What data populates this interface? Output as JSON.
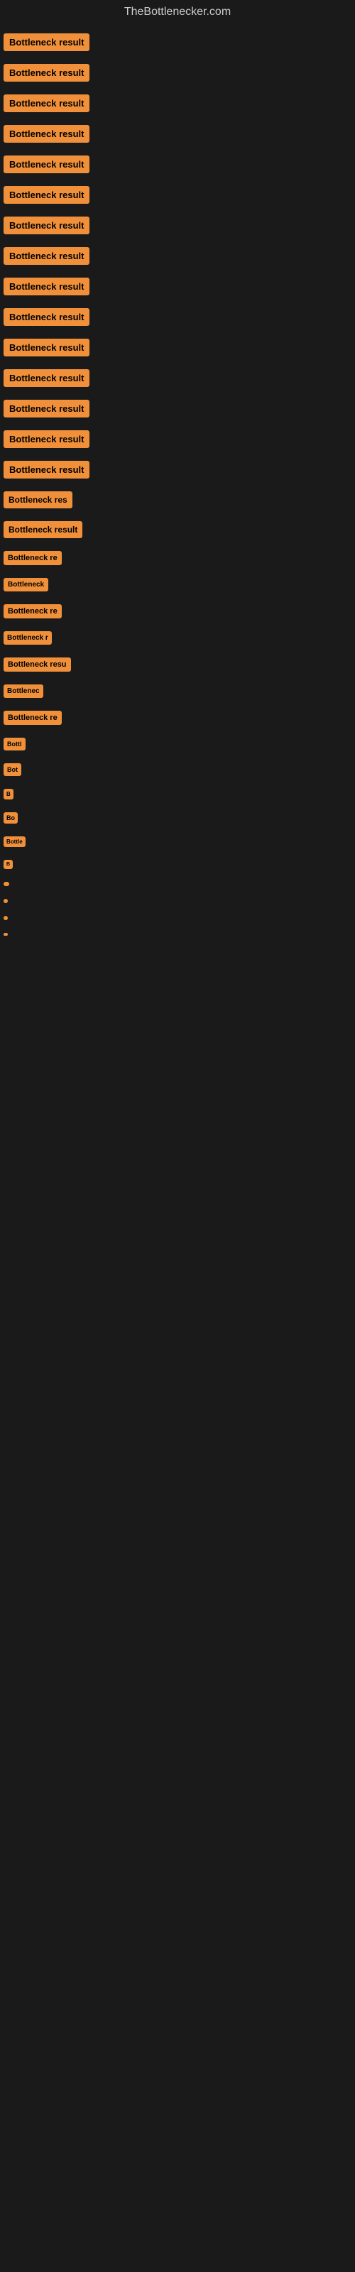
{
  "site": {
    "title": "TheBottlenecker.com"
  },
  "badges": [
    {
      "id": 1,
      "label": "Bottleneck result",
      "overflow": false
    },
    {
      "id": 2,
      "label": "Bottleneck result",
      "overflow": false
    },
    {
      "id": 3,
      "label": "Bottleneck result",
      "overflow": false
    },
    {
      "id": 4,
      "label": "Bottleneck result",
      "overflow": false
    },
    {
      "id": 5,
      "label": "Bottleneck result",
      "overflow": false
    },
    {
      "id": 6,
      "label": "Bottleneck result",
      "overflow": false
    },
    {
      "id": 7,
      "label": "Bottleneck result",
      "overflow": false
    },
    {
      "id": 8,
      "label": "Bottleneck result",
      "overflow": false
    },
    {
      "id": 9,
      "label": "Bottleneck result",
      "overflow": false
    },
    {
      "id": 10,
      "label": "Bottleneck result",
      "overflow": false
    },
    {
      "id": 11,
      "label": "Bottleneck result",
      "overflow": false
    },
    {
      "id": 12,
      "label": "Bottleneck result",
      "overflow": false
    },
    {
      "id": 13,
      "label": "Bottleneck result",
      "overflow": false
    },
    {
      "id": 14,
      "label": "Bottleneck result",
      "overflow": false
    },
    {
      "id": 15,
      "label": "Bottleneck result",
      "overflow": false
    },
    {
      "id": 16,
      "label": "Bottleneck res",
      "overflow": true
    },
    {
      "id": 17,
      "label": "Bottleneck result",
      "overflow": false
    },
    {
      "id": 18,
      "label": "Bottleneck re",
      "overflow": true
    },
    {
      "id": 19,
      "label": "Bottleneck",
      "overflow": true
    },
    {
      "id": 20,
      "label": "Bottleneck re",
      "overflow": true
    },
    {
      "id": 21,
      "label": "Bottleneck r",
      "overflow": true
    },
    {
      "id": 22,
      "label": "Bottleneck resu",
      "overflow": true
    },
    {
      "id": 23,
      "label": "Bottlenec",
      "overflow": true
    },
    {
      "id": 24,
      "label": "Bottleneck re",
      "overflow": true
    },
    {
      "id": 25,
      "label": "Bottl",
      "overflow": true
    },
    {
      "id": 26,
      "label": "Bot",
      "overflow": true
    },
    {
      "id": 27,
      "label": "B",
      "overflow": true
    },
    {
      "id": 28,
      "label": "Bo",
      "overflow": true
    },
    {
      "id": 29,
      "label": "Bottle",
      "overflow": true
    },
    {
      "id": 30,
      "label": "B",
      "overflow": true
    },
    {
      "id": 31,
      "label": "",
      "overflow": true
    },
    {
      "id": 32,
      "label": "",
      "overflow": true
    },
    {
      "id": 33,
      "label": "",
      "overflow": true
    },
    {
      "id": 34,
      "label": "",
      "overflow": true
    }
  ],
  "colors": {
    "badge_bg": "#f0903a",
    "badge_text": "#000000",
    "page_bg": "#1a1a1a",
    "site_title": "#cccccc"
  }
}
